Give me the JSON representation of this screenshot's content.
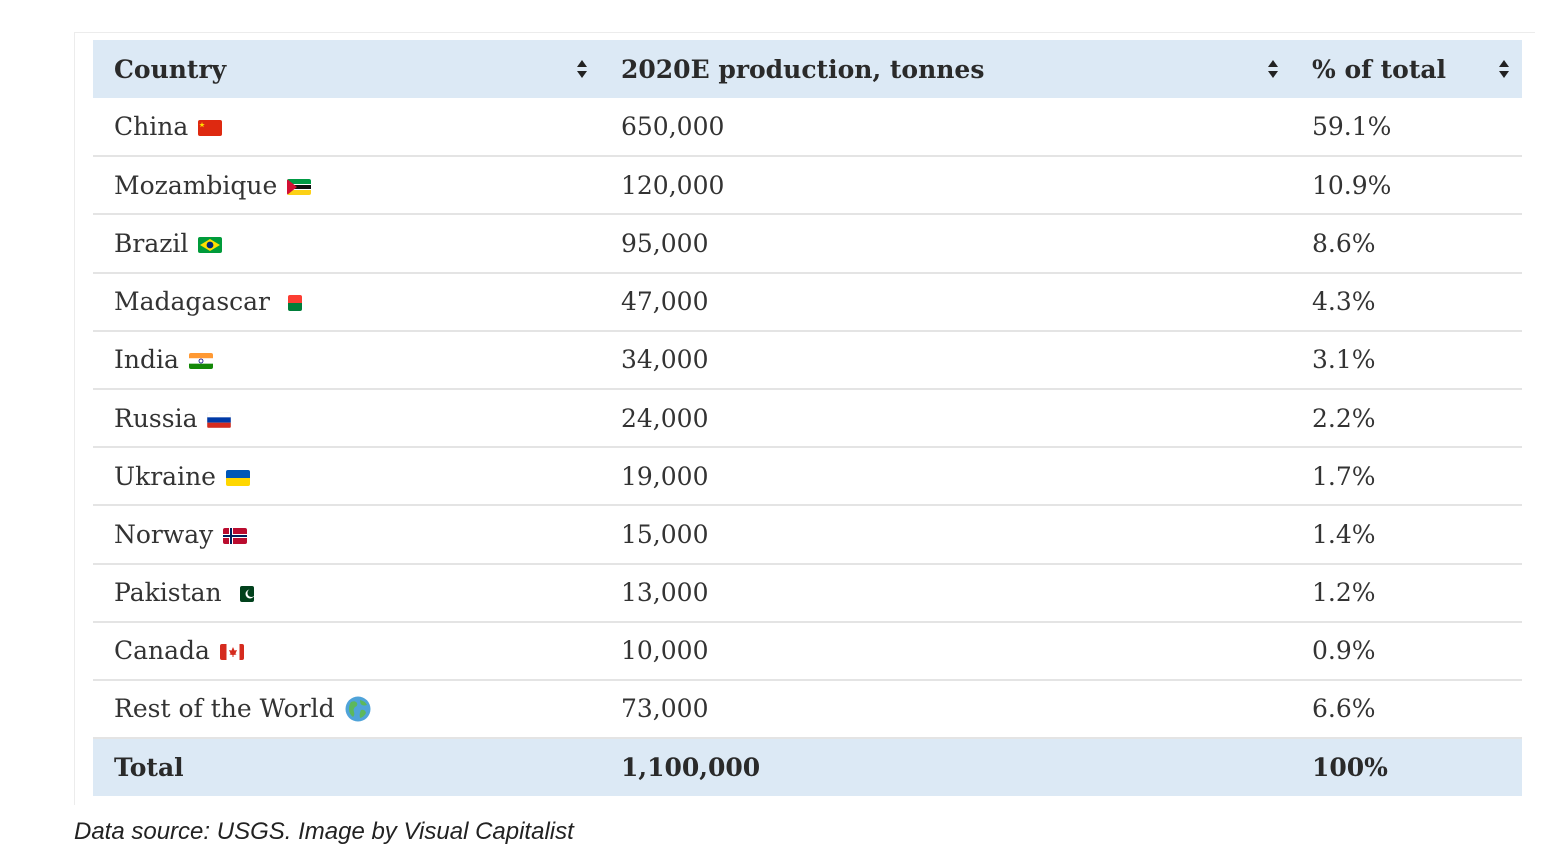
{
  "chart_data": {
    "type": "table",
    "columns": [
      "Country",
      "2020E production, tonnes",
      "% of total"
    ],
    "rows": [
      {
        "country": "China",
        "flag": "china-flag-icon",
        "production": "650,000",
        "percent": "59.1%"
      },
      {
        "country": "Mozambique",
        "flag": "mozambique-flag-icon",
        "production": "120,000",
        "percent": "10.9%"
      },
      {
        "country": "Brazil",
        "flag": "brazil-flag-icon",
        "production": "95,000",
        "percent": "8.6%"
      },
      {
        "country": "Madagascar",
        "flag": "madagascar-flag-icon",
        "production": "47,000",
        "percent": "4.3%"
      },
      {
        "country": "India",
        "flag": "india-flag-icon",
        "production": "34,000",
        "percent": "3.1%"
      },
      {
        "country": "Russia",
        "flag": "russia-flag-icon",
        "production": "24,000",
        "percent": "2.2%"
      },
      {
        "country": "Ukraine",
        "flag": "ukraine-flag-icon",
        "production": "19,000",
        "percent": "1.7%"
      },
      {
        "country": "Norway",
        "flag": "norway-flag-icon",
        "production": "15,000",
        "percent": "1.4%"
      },
      {
        "country": "Pakistan",
        "flag": "pakistan-flag-icon",
        "production": "13,000",
        "percent": "1.2%"
      },
      {
        "country": "Canada",
        "flag": "canada-flag-icon",
        "production": "10,000",
        "percent": "0.9%"
      },
      {
        "country": "Rest of the World",
        "flag": "globe-icon",
        "production": "73,000",
        "percent": "6.6%"
      }
    ],
    "total": {
      "label": "Total",
      "production": "1,100,000",
      "percent": "100%"
    },
    "colors": {
      "header_bg": "#dce9f5",
      "row_border": "#e4e4e4",
      "text": "#333333"
    }
  },
  "caption": "Data source: USGS. Image by Visual Capitalist"
}
